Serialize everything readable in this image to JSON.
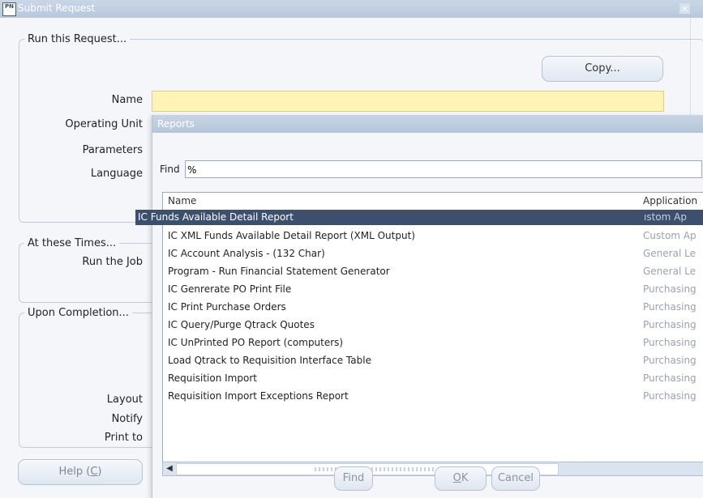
{
  "window": {
    "title": "Submit Request",
    "icon_text": "PN",
    "close_glyph": "×"
  },
  "run_group": {
    "label": "Run this Request...",
    "copy_button": "Copy...",
    "name_label": "Name",
    "operating_unit_label": "Operating Unit",
    "parameters_label": "Parameters",
    "language_label": "Language"
  },
  "times_group": {
    "label": "At these Times...",
    "run_job_label": "Run the Job"
  },
  "completion_group": {
    "label": "Upon Completion...",
    "layout_label": "Layout",
    "notify_label": "Notify",
    "print_to_label": "Print to"
  },
  "help_button": {
    "text": "Help (",
    "key": "C",
    "end": ")"
  },
  "reports_dialog": {
    "title": "Reports",
    "find_label": "Find",
    "find_value": "%",
    "columns": [
      "Name",
      "Application"
    ],
    "selected": {
      "name": "IC Funds Available Detail Report",
      "app": "ıstom Ap"
    },
    "rows": [
      {
        "name": "IC XML Funds Available Detail Report (XML Output)",
        "app": "Custom Ap"
      },
      {
        "name": "IC Account Analysis - (132 Char)",
        "app": "General Le"
      },
      {
        "name": "Program - Run Financial Statement Generator",
        "app": "General Le"
      },
      {
        "name": "IC Genrerate PO Print File",
        "app": "Purchasing"
      },
      {
        "name": "IC Print Purchase Orders",
        "app": "Purchasing"
      },
      {
        "name": "IC Query/Purge Qtrack Quotes",
        "app": "Purchasing"
      },
      {
        "name": "IC UnPrinted PO Report (computers)",
        "app": "Purchasing"
      },
      {
        "name": "Load Qtrack to Requisition Interface Table",
        "app": "Purchasing"
      },
      {
        "name": "Requisition Import",
        "app": "Purchasing"
      },
      {
        "name": "Requisition Import Exceptions Report",
        "app": "Purchasing"
      }
    ],
    "buttons": {
      "find": "Find",
      "ok_key": "O",
      "ok_rest": "K",
      "cancel": "Cancel"
    }
  },
  "colors": {
    "title_bar": "#b8c8dc",
    "selection": "#3c4f6c",
    "name_field": "#fff4b5"
  }
}
